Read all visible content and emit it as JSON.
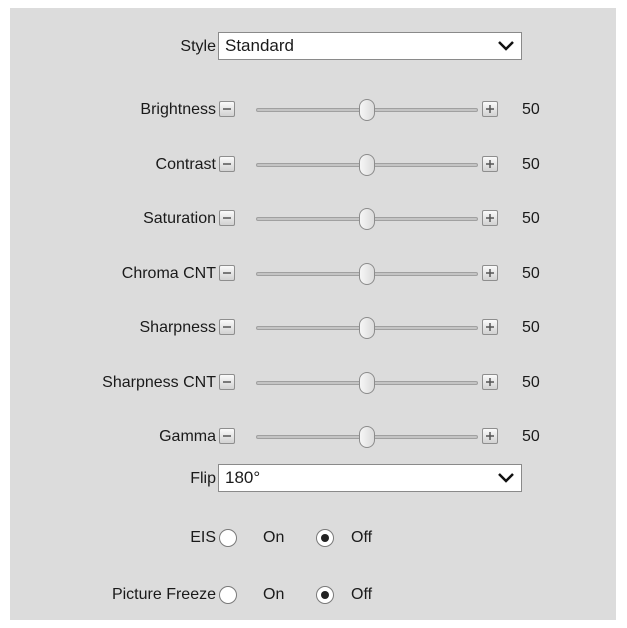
{
  "style": {
    "label": "Style",
    "value": "Standard"
  },
  "sliders": [
    {
      "label": "Brightness",
      "value": "50",
      "level": 50
    },
    {
      "label": "Contrast",
      "value": "50",
      "level": 50
    },
    {
      "label": "Saturation",
      "value": "50",
      "level": 50
    },
    {
      "label": "Chroma CNT",
      "value": "50",
      "level": 50
    },
    {
      "label": "Sharpness",
      "value": "50",
      "level": 50
    },
    {
      "label": "Sharpness CNT",
      "value": "50",
      "level": 50
    },
    {
      "label": "Gamma",
      "value": "50",
      "level": 50
    }
  ],
  "flip": {
    "label": "Flip",
    "value": "180°"
  },
  "eis": {
    "label": "EIS",
    "on_label": "On",
    "off_label": "Off",
    "selected": "Off"
  },
  "picture_freeze": {
    "label": "Picture Freeze",
    "on_label": "On",
    "off_label": "Off",
    "selected": "Off"
  },
  "icons": {
    "minus": "minus-icon",
    "plus": "plus-icon",
    "dropdown": "chevron-down-icon"
  }
}
